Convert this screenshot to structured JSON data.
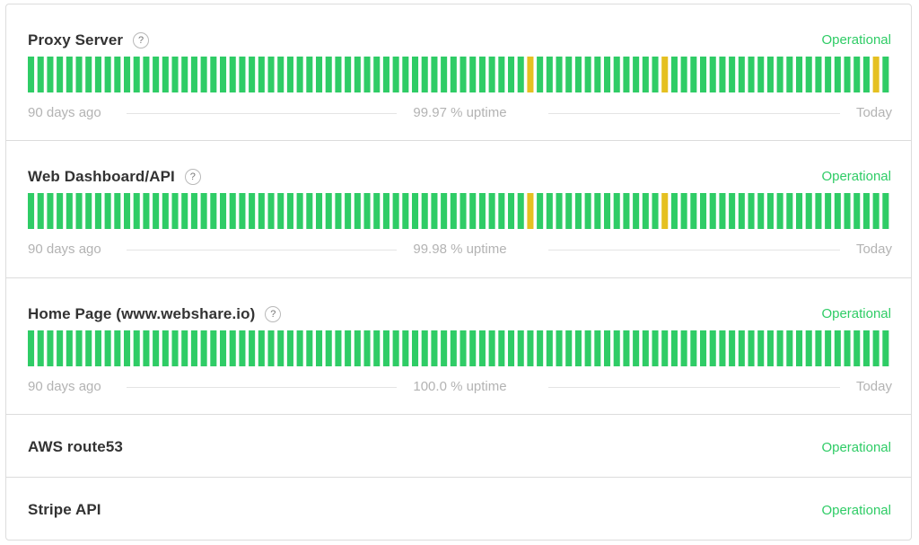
{
  "colors": {
    "operational": "#2fcc66",
    "degraded": "#e5c021",
    "bar_up": "#2fcc66"
  },
  "icons": {
    "help": "question-circle-icon"
  },
  "legend": {
    "start": "90 days ago",
    "end": "Today"
  },
  "components": [
    {
      "name": "Proxy Server",
      "status": "Operational",
      "has_help": true,
      "uptime_label": "99.97 % uptime",
      "days": 90,
      "degraded_days": [
        52,
        66,
        88
      ]
    },
    {
      "name": "Web Dashboard/API",
      "status": "Operational",
      "has_help": true,
      "uptime_label": "99.98 % uptime",
      "days": 90,
      "degraded_days": [
        52,
        66
      ]
    },
    {
      "name": "Home Page (www.webshare.io)",
      "status": "Operational",
      "has_help": true,
      "uptime_label": "100.0 % uptime",
      "days": 90,
      "degraded_days": []
    },
    {
      "name": "AWS route53",
      "status": "Operational",
      "has_help": false
    },
    {
      "name": "Stripe API",
      "status": "Operational",
      "has_help": false
    }
  ]
}
